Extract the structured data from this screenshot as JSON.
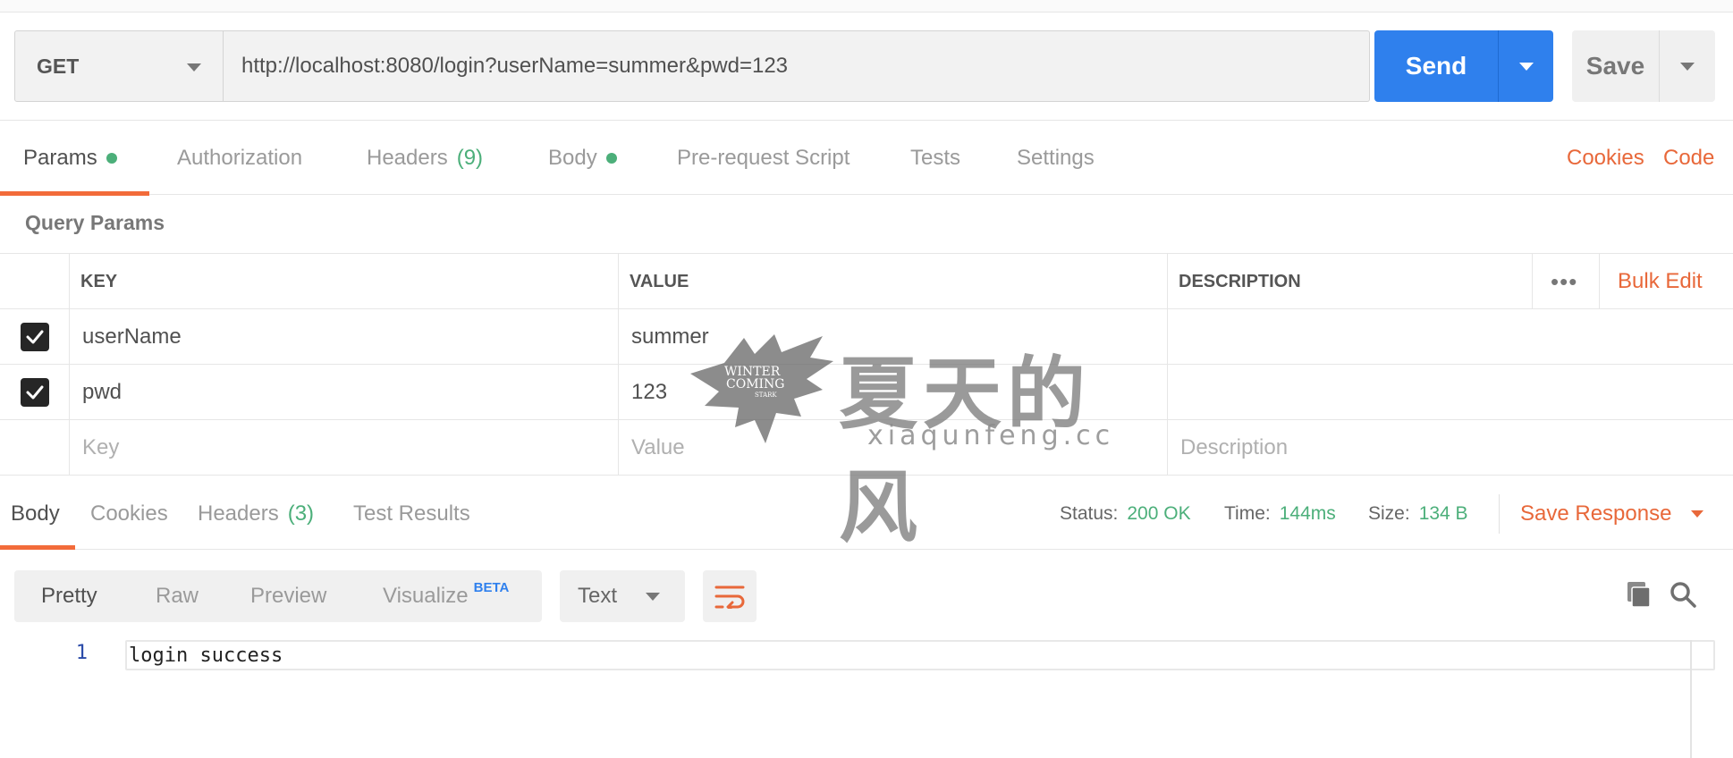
{
  "request": {
    "method": "GET",
    "url": "http://localhost:8080/login?userName=summer&pwd=123",
    "send_label": "Send",
    "save_label": "Save"
  },
  "request_tabs": {
    "params": "Params",
    "authorization": "Authorization",
    "headers": "Headers",
    "headers_count": "(9)",
    "body": "Body",
    "pre_request_script": "Pre-request Script",
    "tests": "Tests",
    "settings": "Settings",
    "cookies_link": "Cookies",
    "code_link": "Code"
  },
  "query_params": {
    "title": "Query Params",
    "columns": {
      "key": "KEY",
      "value": "VALUE",
      "description": "DESCRIPTION"
    },
    "more_label": "•••",
    "bulk_edit": "Bulk Edit",
    "rows": [
      {
        "checked": true,
        "key": "userName",
        "value": "summer",
        "description": ""
      },
      {
        "checked": true,
        "key": "pwd",
        "value": "123",
        "description": ""
      }
    ],
    "placeholders": {
      "key": "Key",
      "value": "Value",
      "description": "Description"
    }
  },
  "watermark": {
    "logo_text_line1": "WINTER",
    "logo_text_line2": "COMING",
    "logo_text_line3": "STARK",
    "title": "夏天的风",
    "site": "xiaqunfeng.cc"
  },
  "response": {
    "tabs": {
      "body": "Body",
      "cookies": "Cookies",
      "headers": "Headers",
      "headers_count": "(3)",
      "test_results": "Test Results"
    },
    "status_label": "Status:",
    "status_value": "200 OK",
    "time_label": "Time:",
    "time_value": "144ms",
    "size_label": "Size:",
    "size_value": "134 B",
    "save_response": "Save Response",
    "views": {
      "pretty": "Pretty",
      "raw": "Raw",
      "preview": "Preview",
      "visualize": "Visualize",
      "beta": "BETA"
    },
    "format": "Text",
    "icons": {
      "wrap": "wrap-lines-icon",
      "copy": "copy-icon",
      "search": "search-icon"
    },
    "lines": [
      {
        "number": "1",
        "text": "login success"
      }
    ]
  },
  "colors": {
    "accent_orange": "#e8683a",
    "send_blue": "#2f80ed",
    "status_green": "#4caf7a"
  }
}
